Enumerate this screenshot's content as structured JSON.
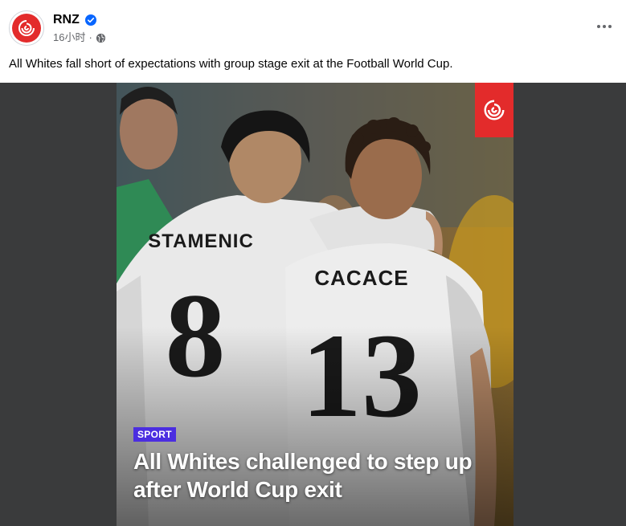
{
  "post": {
    "page_name": "RNZ",
    "timestamp": "16小时",
    "separator": "·",
    "caption": "All Whites fall short of expectations with group stage exit at the Football World Cup."
  },
  "icons": {
    "avatar": "rnz-logo-icon",
    "verified": "verified-badge-icon",
    "audience": "globe-icon",
    "more": "more-options-icon",
    "logo_badge": "rnz-logo-icon"
  },
  "image": {
    "players": [
      {
        "name": "STAMENIC",
        "number": "8"
      },
      {
        "name": "CACACE",
        "number": "13"
      }
    ],
    "tag": "SPORT",
    "headline": "All Whites challenged to step up after World Cup exit"
  },
  "colors": {
    "brand_red": "#e32b2b",
    "verified_blue": "#0866ff",
    "sport_tag": "#4b2ee0"
  }
}
